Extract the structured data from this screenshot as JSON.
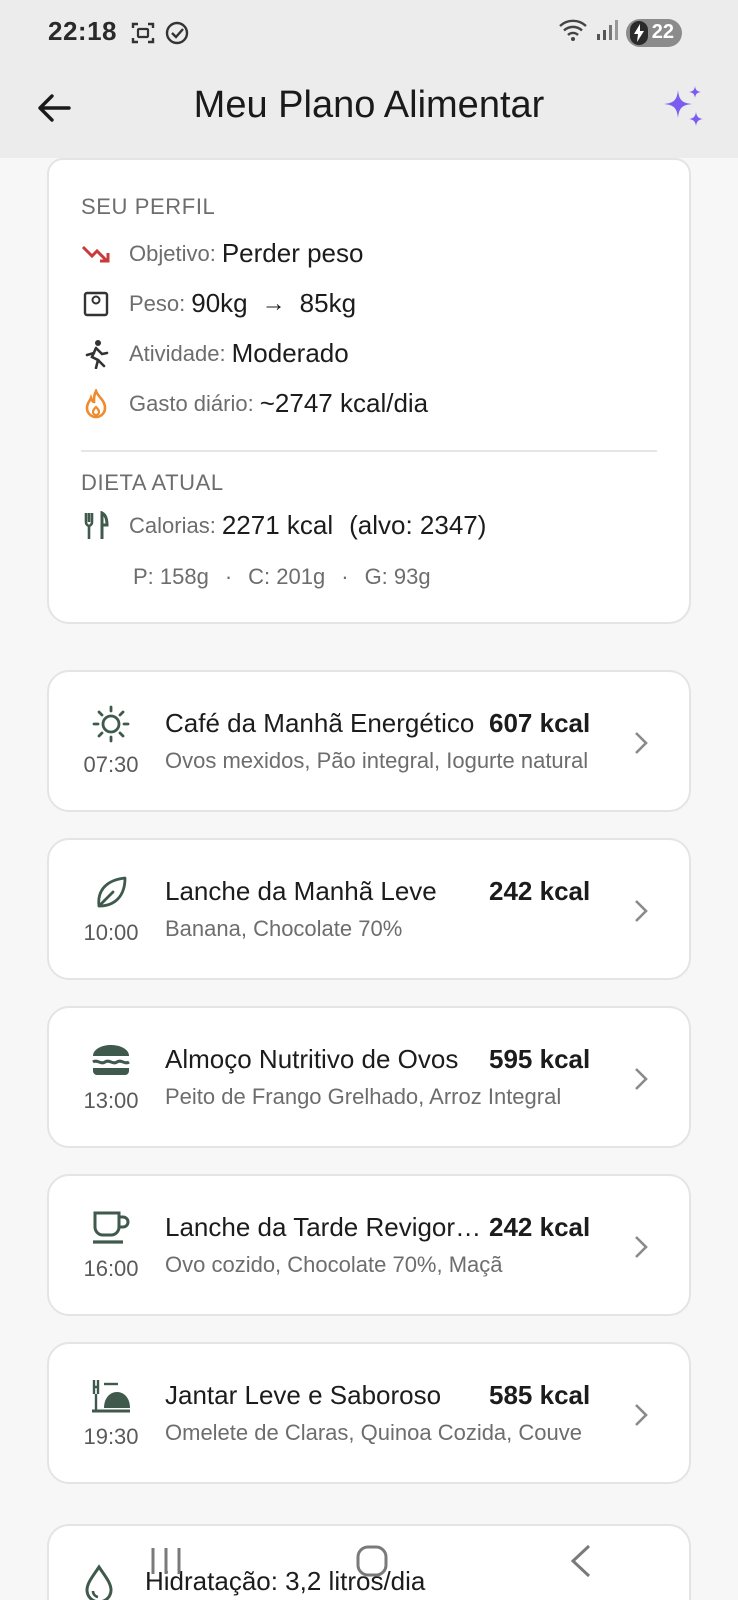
{
  "status_bar": {
    "time": "22:18",
    "battery": "22"
  },
  "app_bar": {
    "title": "Meu Plano Alimentar"
  },
  "profile": {
    "section_title": "SEU PERFIL",
    "goal_label": "Objetivo:",
    "goal_value": "Perder peso",
    "weight_label": "Peso:",
    "weight_current": "90kg",
    "weight_arrow": "→",
    "weight_target": "85kg",
    "activity_label": "Atividade:",
    "activity_value": "Moderado",
    "expenditure_label": "Gasto diário:",
    "expenditure_value": "~2747 kcal/dia"
  },
  "diet": {
    "section_title": "DIETA ATUAL",
    "calories_label": "Calorias:",
    "calories_value": "2271 kcal",
    "target_value": "(alvo: 2347)",
    "protein": "P: 158g",
    "carbs": "C: 201g",
    "fat": "G: 93g",
    "separator": "·"
  },
  "meals": [
    {
      "time": "07:30",
      "title": "Café da Manhã Energético",
      "kcal": "607 kcal",
      "items": "Ovos mexidos, Pão integral, Iogurte natural",
      "icon": "sun-icon"
    },
    {
      "time": "10:00",
      "title": "Lanche da Manhã Leve",
      "kcal": "242 kcal",
      "items": "Banana, Chocolate 70%",
      "icon": "leaf-icon"
    },
    {
      "time": "13:00",
      "title": "Almoço Nutritivo de Ovos",
      "kcal": "595 kcal",
      "items": "Peito de Frango Grelhado, Arroz Integral",
      "icon": "burger-icon"
    },
    {
      "time": "16:00",
      "title": "Lanche da Tarde Revigorante",
      "kcal": "242 kcal",
      "items": "Ovo cozido, Chocolate 70%, Maçã",
      "icon": "coffee-cup-icon"
    },
    {
      "time": "19:30",
      "title": "Jantar Leve e Saboroso",
      "kcal": "585 kcal",
      "items": "Omelete de Claras, Quinoa Cozida, Couve",
      "icon": "dinner-icon"
    }
  ],
  "hydration": {
    "text": "Hidratação: 3,2 litros/dia"
  },
  "colors": {
    "accent_purple": "#7b5cf0",
    "goal_red": "#c93a3a",
    "fire_orange": "#f08a2c",
    "meal_icon": "#3f5a4c"
  }
}
